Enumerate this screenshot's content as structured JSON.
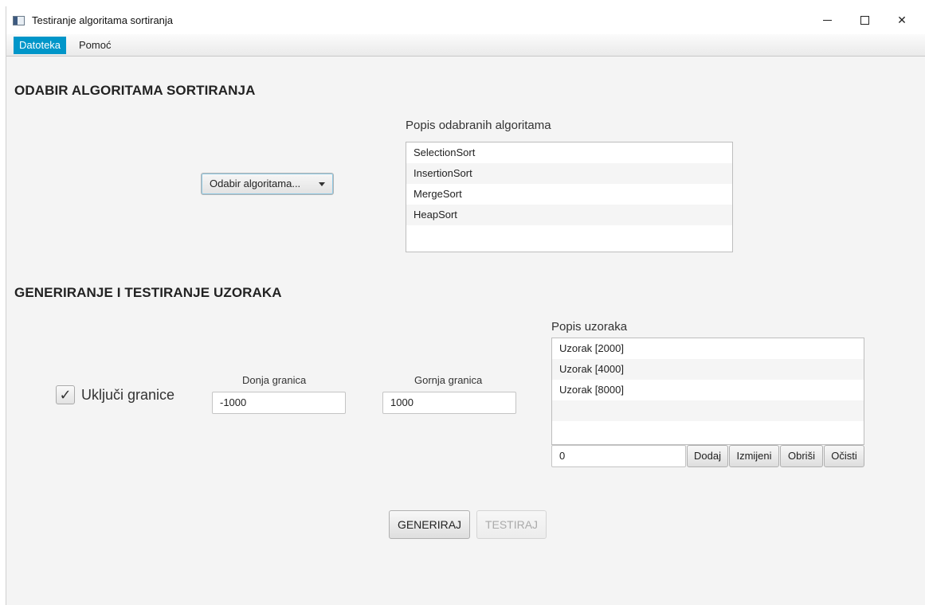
{
  "window": {
    "title": "Testiranje algoritama sortiranja",
    "minimize_symbol": "",
    "maximize_symbol": "",
    "close_symbol": "✕"
  },
  "menu": {
    "items": [
      {
        "label": "Datoteka",
        "active": true
      },
      {
        "label": "Pomoć",
        "active": false
      }
    ]
  },
  "algorithms_section": {
    "title": "ODABIR ALGORITAMA SORTIRANJA",
    "combo_value": "Odabir algoritama...",
    "list_label": "Popis odabranih algoritama",
    "list_items": [
      "SelectionSort",
      "InsertionSort",
      "MergeSort",
      "HeapSort"
    ]
  },
  "samples_section": {
    "title": "GENERIRANJE I TESTIRANJE UZORAKA",
    "checkbox_label": "Uključi granice",
    "checkbox_checked": true,
    "checkbox_mark": "✓",
    "lower_label": "Donja granica",
    "lower_value": "-1000",
    "upper_label": "Gornja granica",
    "upper_value": "1000",
    "list_label": "Popis uzoraka",
    "list_items": [
      "Uzorak  [2000]",
      "Uzorak  [4000]",
      "Uzorak  [8000]"
    ],
    "size_input_value": "0",
    "buttons": {
      "add": "Dodaj",
      "edit": "Izmijeni",
      "delete": "Obriši",
      "clear": "Očisti"
    }
  },
  "actions": {
    "generate": "GENERIRAJ",
    "test": "TESTIRAJ"
  },
  "colors": {
    "menu_active": "#0096c9",
    "background": "#f4f4f4"
  }
}
